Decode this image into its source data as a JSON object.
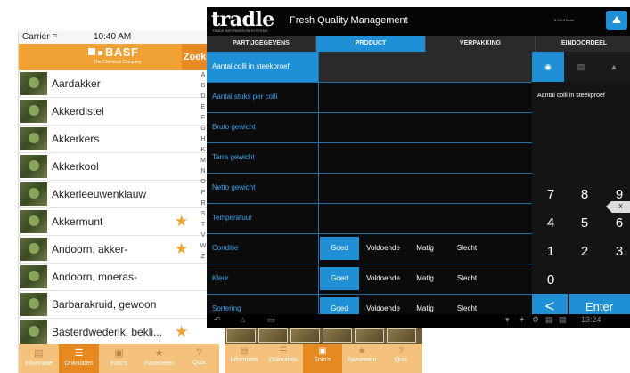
{
  "phone": {
    "status": {
      "carrier": "Carrier",
      "wifi": "wifi-icon",
      "time": "10:40 AM"
    },
    "header": {
      "logo": "BASF",
      "logo_sub": "The Chemical Company",
      "search_button": "Zoeken"
    },
    "items": [
      {
        "name": "Aardakker",
        "favorite": false
      },
      {
        "name": "Akkerdistel",
        "favorite": false
      },
      {
        "name": "Akkerkers",
        "favorite": false
      },
      {
        "name": "Akkerkool",
        "favorite": false
      },
      {
        "name": "Akkerleeuwenklauw",
        "favorite": false
      },
      {
        "name": "Akkermunt",
        "favorite": true
      },
      {
        "name": "Andoorn, akker-",
        "favorite": true
      },
      {
        "name": "Andoorn, moeras-",
        "favorite": false
      },
      {
        "name": "Barbarakruid, gewoon",
        "favorite": false
      },
      {
        "name": "Basterdwederik, bekli...",
        "favorite": true
      }
    ],
    "index": [
      "A",
      "B",
      "D",
      "E",
      "F",
      "G",
      "H",
      "K",
      "M",
      "N",
      "O",
      "P",
      "R",
      "S",
      "T",
      "V",
      "W",
      "Z"
    ],
    "tabs": [
      {
        "label": "Informatie",
        "icon": "book-icon",
        "active": false
      },
      {
        "label": "Onkruiden",
        "icon": "list-icon",
        "active": true
      },
      {
        "label": "Foto's",
        "icon": "photo-icon",
        "active": false
      },
      {
        "label": "Favorieten",
        "icon": "star-icon",
        "active": false
      },
      {
        "label": "Quiz",
        "icon": "question-icon",
        "active": false
      }
    ]
  },
  "tablet": {
    "logo": "tradle",
    "logo_sub": "TRADE INFORMATION SYSTEMS",
    "title": "Fresh Quality Management",
    "version": "6.3.0.1 Beta",
    "tabs": [
      "PARTIJGEGEVENS",
      "PRODUCT",
      "VERPAKKING",
      "EINDOORDEEL"
    ],
    "active_tab": 1,
    "rows": [
      {
        "label": "Aantal colli in steekproef",
        "options": []
      },
      {
        "label": "Aantal stuks per colli",
        "options": []
      },
      {
        "label": "Bruto gewicht",
        "options": []
      },
      {
        "label": "Tarra gewicht",
        "options": []
      },
      {
        "label": "Netto gewicht",
        "options": []
      },
      {
        "label": "Temperatuur",
        "options": []
      },
      {
        "label": "Conditie",
        "options": [
          "Goed",
          "Voldoende",
          "Matig",
          "Slecht"
        ],
        "selected": 0
      },
      {
        "label": "Kleur",
        "options": [
          "Goed",
          "Voldoende",
          "Matig",
          "Slecht"
        ],
        "selected": 0
      },
      {
        "label": "Sortering",
        "options": [
          "Goed",
          "Voldoende",
          "Matig",
          "Slecht"
        ],
        "selected": 0
      }
    ],
    "keypad": {
      "field_label": "Aantal colli in steekproef",
      "clear": "X",
      "keys": [
        "7",
        "8",
        "9",
        "4",
        "5",
        "6",
        "1",
        "2",
        "3",
        "0"
      ],
      "back": "<",
      "enter": "Enter"
    },
    "android": {
      "clock": "13:24"
    },
    "bottom_tabs": [
      {
        "label": "Informatie",
        "icon": "book-icon",
        "active": false
      },
      {
        "label": "Onkruiden",
        "icon": "list-icon",
        "active": false
      },
      {
        "label": "Foto's",
        "icon": "photo-icon",
        "active": true
      },
      {
        "label": "Favorieten",
        "icon": "star-icon",
        "active": false
      },
      {
        "label": "Quiz",
        "icon": "question-icon",
        "active": false
      }
    ]
  },
  "colors": {
    "orange": "#f0a133",
    "blue": "#1f8fd6"
  }
}
